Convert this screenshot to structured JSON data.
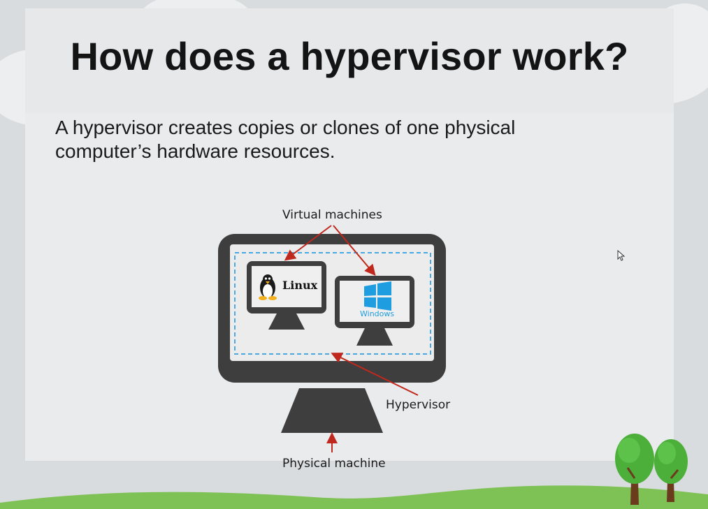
{
  "slide": {
    "title": "How does a hypervisor work?",
    "subtitle": "A hypervisor creates copies or clones of one physical computer’s hardware resources."
  },
  "diagram": {
    "labels": {
      "virtual_machines": "Virtual machines",
      "hypervisor": "Hypervisor",
      "physical_machine": "Physical machine"
    },
    "vm_linux": {
      "name": "Linux"
    },
    "vm_windows": {
      "name": "Windows"
    }
  },
  "colors": {
    "monitor_frame": "#3e3e3e",
    "screen": "#ececec",
    "dashed_border": "#4aa8e0",
    "arrow": "#c0281e",
    "windows_blue": "#1e9de0",
    "tree_green": "#4caf3a",
    "grass": "#7ec255"
  }
}
